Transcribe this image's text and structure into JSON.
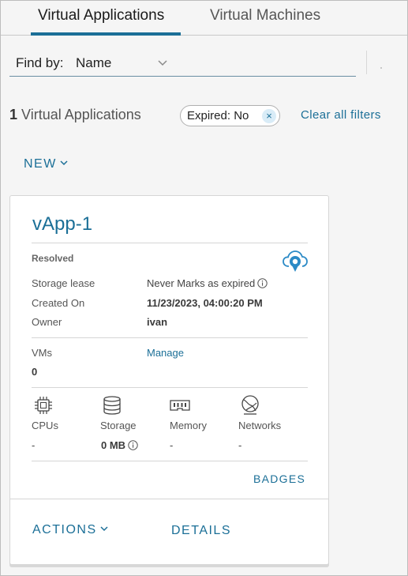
{
  "tabs": [
    {
      "label": "Virtual Applications",
      "active": true
    },
    {
      "label": "Virtual Machines",
      "active": false
    }
  ],
  "find_by": {
    "label": "Find by:",
    "value": "Name"
  },
  "results": {
    "count": "1",
    "label": "Virtual Applications"
  },
  "filter": {
    "text": "Expired: No",
    "close": "×"
  },
  "clear_filters": "Clear all filters",
  "new_button": "NEW",
  "card": {
    "title": "vApp-1",
    "status": "Resolved",
    "storage_lease_label": "Storage lease",
    "storage_lease_value": "Never Marks as expired",
    "created_on_label": "Created On",
    "created_on_value": "11/23/2023, 04:00:20 PM",
    "owner_label": "Owner",
    "owner_value": "ivan",
    "vms_label": "VMs",
    "vms_value": "0",
    "manage_link": "Manage",
    "resources": [
      {
        "label": "CPUs",
        "value": "-",
        "icon": "cpu-icon"
      },
      {
        "label": "Storage",
        "value": "0 MB",
        "icon": "storage-icon"
      },
      {
        "label": "Memory",
        "value": "-",
        "icon": "memory-icon"
      },
      {
        "label": "Networks",
        "value": "-",
        "icon": "network-icon"
      }
    ],
    "badges_button": "BADGES",
    "actions_button": "ACTIONS",
    "details_button": "DETAILS"
  },
  "colors": {
    "accent": "#1b6f97",
    "background": "#f5f5f5",
    "card": "#ffffff"
  }
}
